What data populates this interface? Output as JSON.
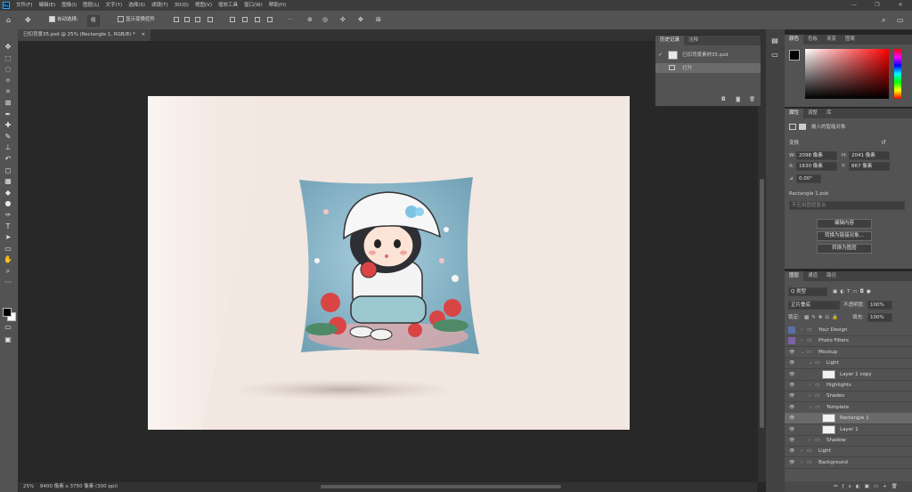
{
  "menubar": {
    "items": [
      "文件(F)",
      "编辑(E)",
      "图像(I)",
      "图层(L)",
      "文字(Y)",
      "选择(S)",
      "滤镜(T)",
      "3D(D)",
      "视图(V)",
      "增效工具",
      "窗口(W)",
      "帮助(H)"
    ]
  },
  "options": {
    "auto_select_label": "自动选择:",
    "auto_select_value": "组",
    "show_transform_label": "显示变换控件",
    "more": "···"
  },
  "document": {
    "tab_title": "已扣背景35.psd @ 25% (Rectangle 1, RGB/8) *",
    "tab_close": "×"
  },
  "status": {
    "zoom": "25%",
    "size": "8400 像素 x 3750 像素 (300 ppi)"
  },
  "history_panel": {
    "tabs": [
      "历史记录",
      "注释"
    ],
    "snapshot": "已扣背景素材35.psd",
    "step": "打开"
  },
  "color_panel": {
    "tabs": [
      "颜色",
      "色板",
      "渐变",
      "图案"
    ],
    "hue_hex": "#ff0000"
  },
  "properties_panel": {
    "tabs": [
      "属性",
      "调整",
      "库"
    ],
    "kind": "嵌入的智能对象",
    "transform_label": "变换",
    "w_label": "W:",
    "w_value": "2098 像素",
    "h_label": "H:",
    "h_value": "2041 像素",
    "x_label": "X:",
    "x_value": "1630 像素",
    "y_label": "Y:",
    "y_value": "867 像素",
    "angle": "0.00°",
    "file_name": "Rectangle 1.psb",
    "comp_placeholder": "不应用图层复合",
    "btn_edit": "编辑内容",
    "btn_convert": "转换为链接对象...",
    "btn_layers": "转换为图层"
  },
  "layers_panel": {
    "tabs": [
      "图层",
      "通道",
      "路径"
    ],
    "filter": "Q 类型",
    "blend_mode": "正片叠底",
    "opacity_label": "不透明度:",
    "opacity_value": "100%",
    "lock_label": "锁定:",
    "fill_label": "填充:",
    "fill_value": "100%",
    "layers": [
      {
        "name": "Your Design",
        "type": "group",
        "color": "#5c6ea6",
        "indent": 0
      },
      {
        "name": "Photo Filters",
        "type": "group",
        "color": "#7b62a8",
        "indent": 0
      },
      {
        "name": "Mockup",
        "type": "group",
        "indent": 0,
        "open": true
      },
      {
        "name": "Light",
        "type": "group",
        "indent": 1,
        "open": true
      },
      {
        "name": "Layer 1 copy",
        "type": "layer",
        "indent": 2
      },
      {
        "name": "Highlights",
        "type": "group",
        "indent": 1
      },
      {
        "name": "Shades",
        "type": "group",
        "indent": 1
      },
      {
        "name": "Template",
        "type": "group",
        "indent": 1,
        "open": true
      },
      {
        "name": "Rectangle 1",
        "type": "smart",
        "indent": 2,
        "selected": true
      },
      {
        "name": "Layer 1",
        "type": "layer",
        "indent": 2
      },
      {
        "name": "Shadow",
        "type": "group",
        "indent": 1
      },
      {
        "name": "Light",
        "type": "group",
        "indent": 0
      },
      {
        "name": "Background",
        "type": "group",
        "indent": 0
      }
    ]
  }
}
